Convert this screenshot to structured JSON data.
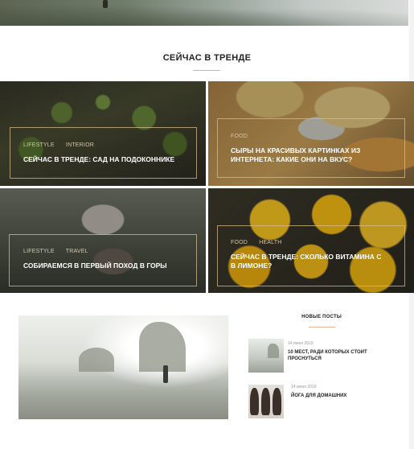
{
  "trending": {
    "title": "СЕЙЧАС В ТРЕНДЕ",
    "tiles": [
      {
        "categories": [
          "LIFESTYLE",
          "INTERIOR"
        ],
        "title": "СЕЙЧАС В ТРЕНДЕ: САД НА ПОДОКОННИКЕ"
      },
      {
        "categories": [
          "FOOD"
        ],
        "title": "СЫРЫ НА КРАСИВЫХ КАРТИНКАХ ИЗ ИНТЕРНЕТА: КАКИЕ ОНИ НА ВКУС?"
      },
      {
        "categories": [
          "LIFESTYLE",
          "TRAVEL"
        ],
        "title": "СОБИРАЕМСЯ В ПЕРВЫЙ ПОХОД В ГОРЫ"
      },
      {
        "categories": [
          "FOOD",
          "HEALTH"
        ],
        "title": "СЕЙЧАС В ТРЕНДЕ: СКОЛЬКО ВИТАМИНА С В ЛИМОНЕ?"
      }
    ]
  },
  "new_posts": {
    "title": "НОВЫЕ ПОСТЫ",
    "items": [
      {
        "date": "14 июня 2019",
        "title": "10 МЕСТ, РАДИ КОТОРЫХ СТОИТ ПРОСНУТЬСЯ"
      },
      {
        "date": "14 июня 2019",
        "title": "ЙОГА ДЛЯ ДОМАШНИХ"
      }
    ]
  },
  "colors": {
    "accent_underline": "#d9b29a",
    "category_text": "#d8c6a4",
    "tile_frame": "#d6be8c"
  }
}
